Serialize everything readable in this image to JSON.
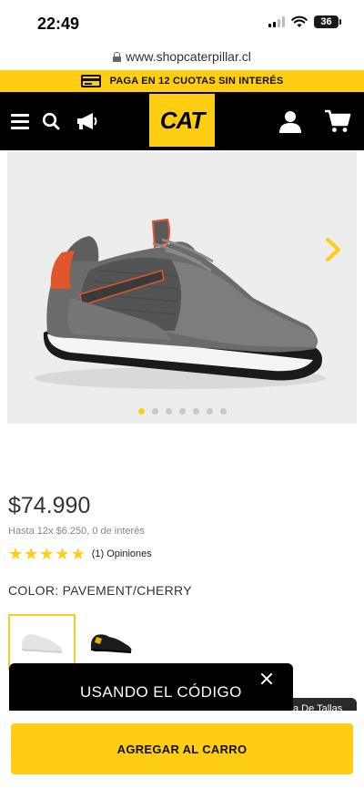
{
  "status_bar": {
    "time": "22:49",
    "battery": "36"
  },
  "browser": {
    "url": "www.shopcaterpillar.cl"
  },
  "promo_banner": {
    "text": "PAGA EN 12 CUOTAS SIN INTERÉS",
    "icon": "credit-card-icon"
  },
  "header": {
    "logo": "CAT",
    "icons": [
      "menu-icon",
      "search-icon",
      "megaphone-icon",
      "user-icon",
      "cart-icon"
    ],
    "background": "#000000",
    "accent": "#ffcd11"
  },
  "gallery": {
    "image_count": 7,
    "active_index": 0,
    "next_icon": "chevron-right-icon"
  },
  "product": {
    "price": "$74.990",
    "installments": "Hasta 12x $6.250, 0 de interés",
    "rating_stars": 5,
    "rating_text": "(1) Opiniones",
    "color_label": "COLOR: PAVEMENT/CHERRY"
  },
  "toast": {
    "text": "USANDO EL CÓDIGO"
  },
  "size_chip": {
    "text": "a De Tallas"
  },
  "footer": {
    "add_to_cart": "AGREGAR AL CARRO"
  }
}
